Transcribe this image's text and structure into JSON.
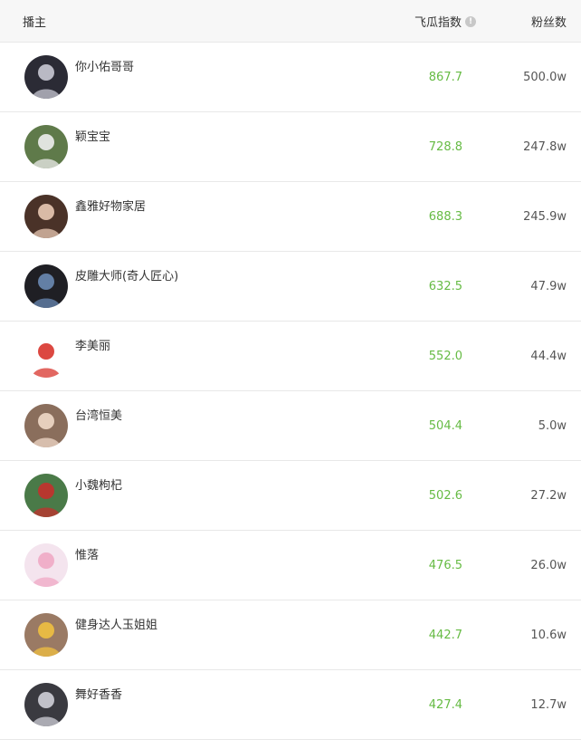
{
  "header": {
    "anchor_label": "播主",
    "index_label": "飞瓜指数",
    "fans_label": "粉丝数"
  },
  "rows": [
    {
      "name": "你小佑哥哥",
      "score": "867.7",
      "fans": "500.0w",
      "avatar_bg": "#2b2b35",
      "avatar_fg": "#c9c9d4"
    },
    {
      "name": "颖宝宝",
      "score": "728.8",
      "fans": "247.8w",
      "avatar_bg": "#5f7a4a",
      "avatar_fg": "#eeeeee"
    },
    {
      "name": "鑫雅好物家居",
      "score": "688.3",
      "fans": "245.9w",
      "avatar_bg": "#4a3228",
      "avatar_fg": "#e9c9b4"
    },
    {
      "name": "皮雕大师(奇人匠心)",
      "score": "632.5",
      "fans": "47.9w",
      "avatar_bg": "#1f1f24",
      "avatar_fg": "#6a8ab4"
    },
    {
      "name": "李美丽",
      "score": "552.0",
      "fans": "44.4w",
      "avatar_bg": "#ffffff",
      "avatar_fg": "#d8342c"
    },
    {
      "name": "台湾恒美",
      "score": "504.4",
      "fans": "5.0w",
      "avatar_bg": "#8a6e5c",
      "avatar_fg": "#f0d9c8"
    },
    {
      "name": "小魏枸杞",
      "score": "502.6",
      "fans": "27.2w",
      "avatar_bg": "#4a7a48",
      "avatar_fg": "#c4302c"
    },
    {
      "name": "惟落",
      "score": "476.5",
      "fans": "26.0w",
      "avatar_bg": "#f4e4ee",
      "avatar_fg": "#f0a8c4"
    },
    {
      "name": "健身达人玉姐姐",
      "score": "442.7",
      "fans": "10.6w",
      "avatar_bg": "#9a7a64",
      "avatar_fg": "#f0c040"
    },
    {
      "name": "舞好香香",
      "score": "427.4",
      "fans": "12.7w",
      "avatar_bg": "#3a3a40",
      "avatar_fg": "#d0d0d8"
    }
  ]
}
